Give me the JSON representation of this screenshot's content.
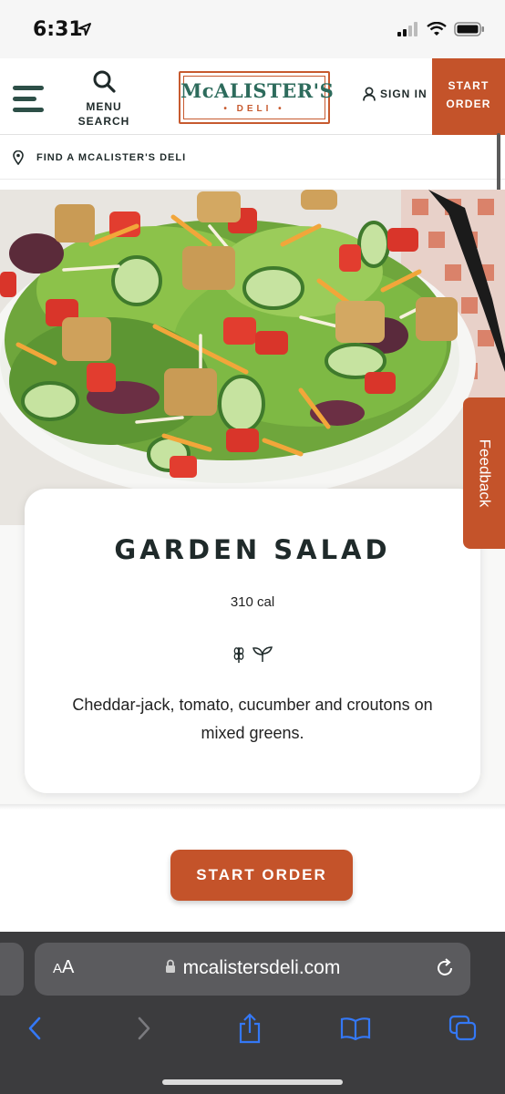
{
  "status_bar": {
    "time": "6:31"
  },
  "header": {
    "menu_label": "MENU",
    "search_label": "SEARCH",
    "logo_name": "McALISTER'S",
    "logo_sub": "• DELI •",
    "sign_in_label": "SIGN IN",
    "start_order_line1": "START",
    "start_order_line2": "ORDER"
  },
  "find_bar": {
    "label": "FIND A MCALISTER'S DELI"
  },
  "product": {
    "title": "GARDEN SALAD",
    "calories": "310 cal",
    "description": "Cheddar-jack, tomato, cucumber and croutons on mixed greens."
  },
  "cta": {
    "start_order_label": "START ORDER"
  },
  "feedback": {
    "label": "Feedback"
  },
  "browser": {
    "aa_label_big": "A",
    "aa_label_small": "A",
    "url": "mcalistersdeli.com"
  },
  "colors": {
    "brand_orange": "#c4532a",
    "brand_green": "#2d6b5c"
  },
  "icons": {
    "hamburger": "hamburger-icon",
    "search": "search-icon",
    "user": "user-icon",
    "location": "location-pin-icon",
    "wheat": "wheat-icon",
    "leaf": "leaf-icon",
    "lock": "lock-icon",
    "reload": "reload-icon",
    "back": "back-icon",
    "forward": "forward-icon",
    "share": "share-icon",
    "bookmarks": "bookmarks-icon",
    "tabs": "tabs-icon"
  }
}
